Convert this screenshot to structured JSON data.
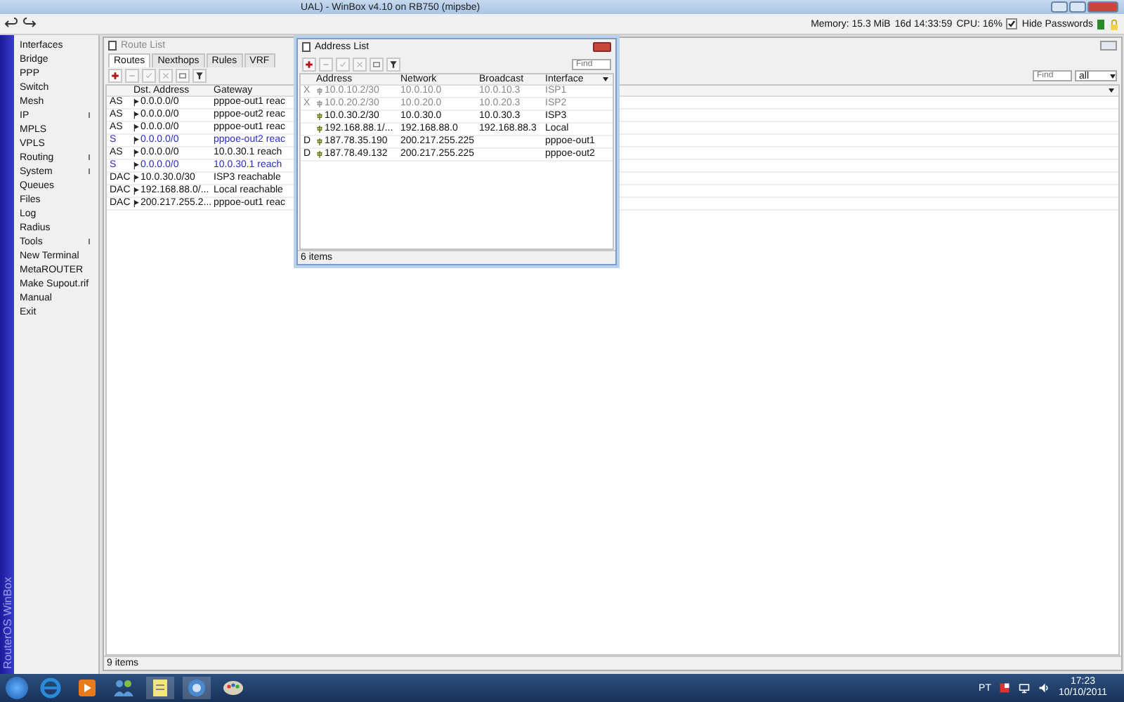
{
  "window": {
    "title": "UAL) - WinBox v4.10 on RB750 (mipsbe)"
  },
  "status": {
    "memory": "Memory: 15.3 MiB",
    "uptime": "16d 14:33:59",
    "cpu": "CPU: 16%",
    "hide_passwords": {
      "label": "Hide Passwords",
      "checked": true
    }
  },
  "brand": "RouterOS WinBox",
  "sidebar": {
    "items": [
      {
        "label": "Interfaces",
        "submenu": false
      },
      {
        "label": "Bridge",
        "submenu": false
      },
      {
        "label": "PPP",
        "submenu": false
      },
      {
        "label": "Switch",
        "submenu": false
      },
      {
        "label": "Mesh",
        "submenu": false
      },
      {
        "label": "IP",
        "submenu": true
      },
      {
        "label": "MPLS",
        "submenu": false
      },
      {
        "label": "VPLS",
        "submenu": false
      },
      {
        "label": "Routing",
        "submenu": true
      },
      {
        "label": "System",
        "submenu": true
      },
      {
        "label": "Queues",
        "submenu": false
      },
      {
        "label": "Files",
        "submenu": false
      },
      {
        "label": "Log",
        "submenu": false
      },
      {
        "label": "Radius",
        "submenu": false
      },
      {
        "label": "Tools",
        "submenu": true
      },
      {
        "label": "New Terminal",
        "submenu": false
      },
      {
        "label": "MetaROUTER",
        "submenu": false
      },
      {
        "label": "Make Supout.rif",
        "submenu": false
      },
      {
        "label": "Manual",
        "submenu": false
      },
      {
        "label": "Exit",
        "submenu": false
      }
    ]
  },
  "route_list": {
    "title": "Route List",
    "tabs": [
      {
        "label": "Routes",
        "selected": true
      },
      {
        "label": "Nexthops",
        "selected": false
      },
      {
        "label": "Rules",
        "selected": false
      },
      {
        "label": "VRF",
        "selected": false
      }
    ],
    "find": {
      "placeholder": "Find"
    },
    "filter_value": "all",
    "columns": [
      "Dst. Address",
      "Gateway"
    ],
    "rows": [
      {
        "flags": "AS",
        "dst": "0.0.0.0/0",
        "gateway": "pppoe-out1 reac",
        "active": true
      },
      {
        "flags": "AS",
        "dst": "0.0.0.0/0",
        "gateway": "pppoe-out2 reac",
        "active": true
      },
      {
        "flags": "AS",
        "dst": "0.0.0.0/0",
        "gateway": "pppoe-out1 reac",
        "active": true
      },
      {
        "flags": "S",
        "dst": "0.0.0.0/0",
        "gateway": "pppoe-out2 reac",
        "active": false
      },
      {
        "flags": "AS",
        "dst": "0.0.0.0/0",
        "gateway": "10.0.30.1 reach",
        "active": true
      },
      {
        "flags": "S",
        "dst": "0.0.0.0/0",
        "gateway": "10.0.30.1 reach",
        "active": false
      },
      {
        "flags": "DAC",
        "dst": "10.0.30.0/30",
        "gateway": "ISP3 reachable",
        "active": true
      },
      {
        "flags": "DAC",
        "dst": "192.168.88.0/...",
        "gateway": "Local reachable",
        "active": true
      },
      {
        "flags": "DAC",
        "dst": "200.217.255.2...",
        "gateway": "pppoe-out1 reac",
        "active": true
      }
    ],
    "status": "9 items"
  },
  "address_list": {
    "title": "Address List",
    "find": {
      "placeholder": "Find"
    },
    "columns": [
      "Address",
      "Network",
      "Broadcast",
      "Interface"
    ],
    "rows": [
      {
        "flags": "X",
        "address": "10.0.10.2/30",
        "network": "10.0.10.0",
        "broadcast": "10.0.10.3",
        "interface": "ISP1",
        "disabled": true
      },
      {
        "flags": "X",
        "address": "10.0.20.2/30",
        "network": "10.0.20.0",
        "broadcast": "10.0.20.3",
        "interface": "ISP2",
        "disabled": true
      },
      {
        "flags": "",
        "address": "10.0.30.2/30",
        "network": "10.0.30.0",
        "broadcast": "10.0.30.3",
        "interface": "ISP3",
        "disabled": false
      },
      {
        "flags": "",
        "address": "192.168.88.1/...",
        "network": "192.168.88.0",
        "broadcast": "192.168.88.3",
        "interface": "Local",
        "disabled": false
      },
      {
        "flags": "D",
        "address": "187.78.35.190",
        "network": "200.217.255.225",
        "broadcast": "",
        "interface": "pppoe-out1",
        "disabled": false
      },
      {
        "flags": "D",
        "address": "187.78.49.132",
        "network": "200.217.255.225",
        "broadcast": "",
        "interface": "pppoe-out2",
        "disabled": false
      }
    ],
    "status": "6 items"
  },
  "taskbar": {
    "language": "PT",
    "time": "17:23",
    "date": "10/10/2011"
  }
}
